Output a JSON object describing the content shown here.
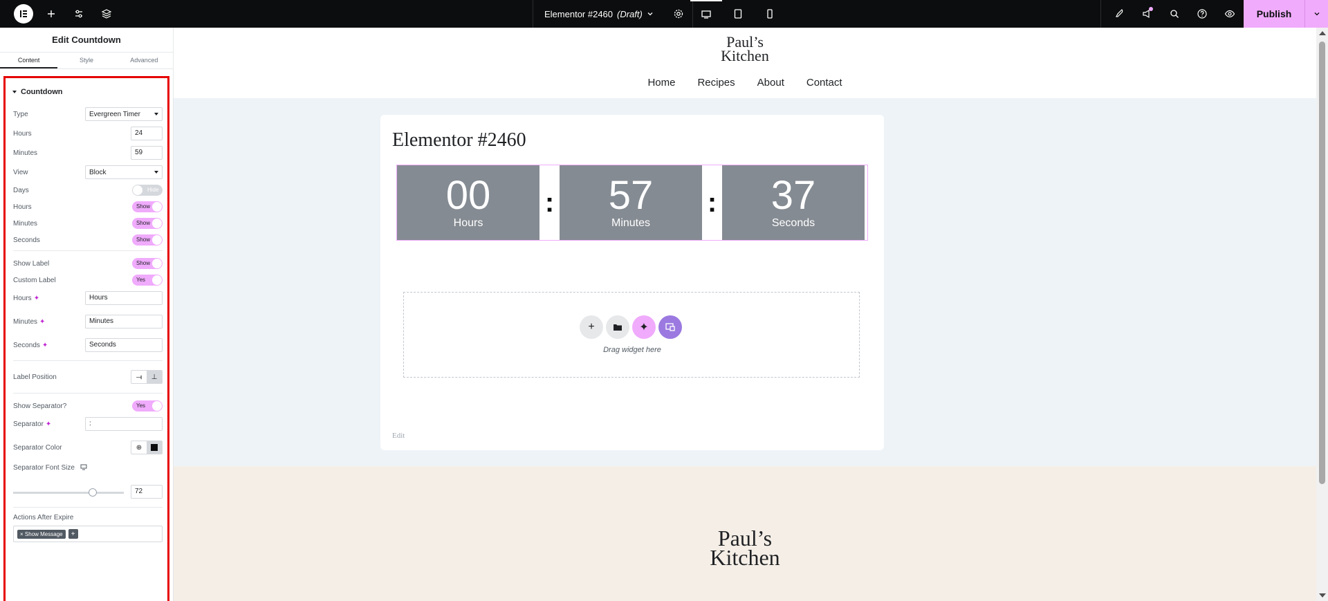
{
  "topbar": {
    "document_title": "Elementor #2460",
    "document_status": "(Draft)",
    "publish_label": "Publish"
  },
  "panel": {
    "title": "Edit Countdown",
    "tabs": [
      "Content",
      "Style",
      "Advanced"
    ],
    "section_title": "Countdown",
    "type_label": "Type",
    "type_value": "Evergreen Timer",
    "hours_label": "Hours",
    "hours_value": "24",
    "minutes_label": "Minutes",
    "minutes_value": "59",
    "view_label": "View",
    "view_value": "Block",
    "days_label": "Days",
    "days_toggle": "Hide",
    "show_hours_label": "Hours",
    "show_hours_toggle": "Show",
    "show_minutes_label": "Minutes",
    "show_minutes_toggle": "Show",
    "show_seconds_label": "Seconds",
    "show_seconds_toggle": "Show",
    "show_label_label": "Show Label",
    "show_label_toggle": "Show",
    "custom_label_label": "Custom Label",
    "custom_label_toggle": "Yes",
    "label_hours_label": "Hours",
    "label_hours_value": "Hours",
    "label_minutes_label": "Minutes",
    "label_minutes_value": "Minutes",
    "label_seconds_label": "Seconds",
    "label_seconds_value": "Seconds",
    "label_position_label": "Label Position",
    "show_separator_label": "Show Separator?",
    "show_separator_toggle": "Yes",
    "separator_label": "Separator",
    "separator_value": ":",
    "separator_color_label": "Separator Color",
    "separator_font_size_label": "Separator Font Size",
    "separator_font_size_value": "72",
    "separator_font_size_slider_fraction": 0.72,
    "actions_after_expire_label": "Actions After Expire",
    "actions_after_expire_tag": "Show Message",
    "colors": {
      "accent": "#f0abfc",
      "highlight_border": "#e60000"
    }
  },
  "site": {
    "brand_line1": "Paul’s",
    "brand_line2": "Kitchen",
    "nav": [
      "Home",
      "Recipes",
      "About",
      "Contact"
    ],
    "page_title": "Elementor #2460",
    "countdown": [
      {
        "digits": "00",
        "label": "Hours"
      },
      {
        "digits": "57",
        "label": "Minutes"
      },
      {
        "digits": "37",
        "label": "Seconds"
      }
    ],
    "separator": ":",
    "dropzone_text": "Drag widget here",
    "edit_link": "Edit",
    "footer_brand_line1": "Paul’s",
    "footer_brand_line2": "Kitchen"
  }
}
